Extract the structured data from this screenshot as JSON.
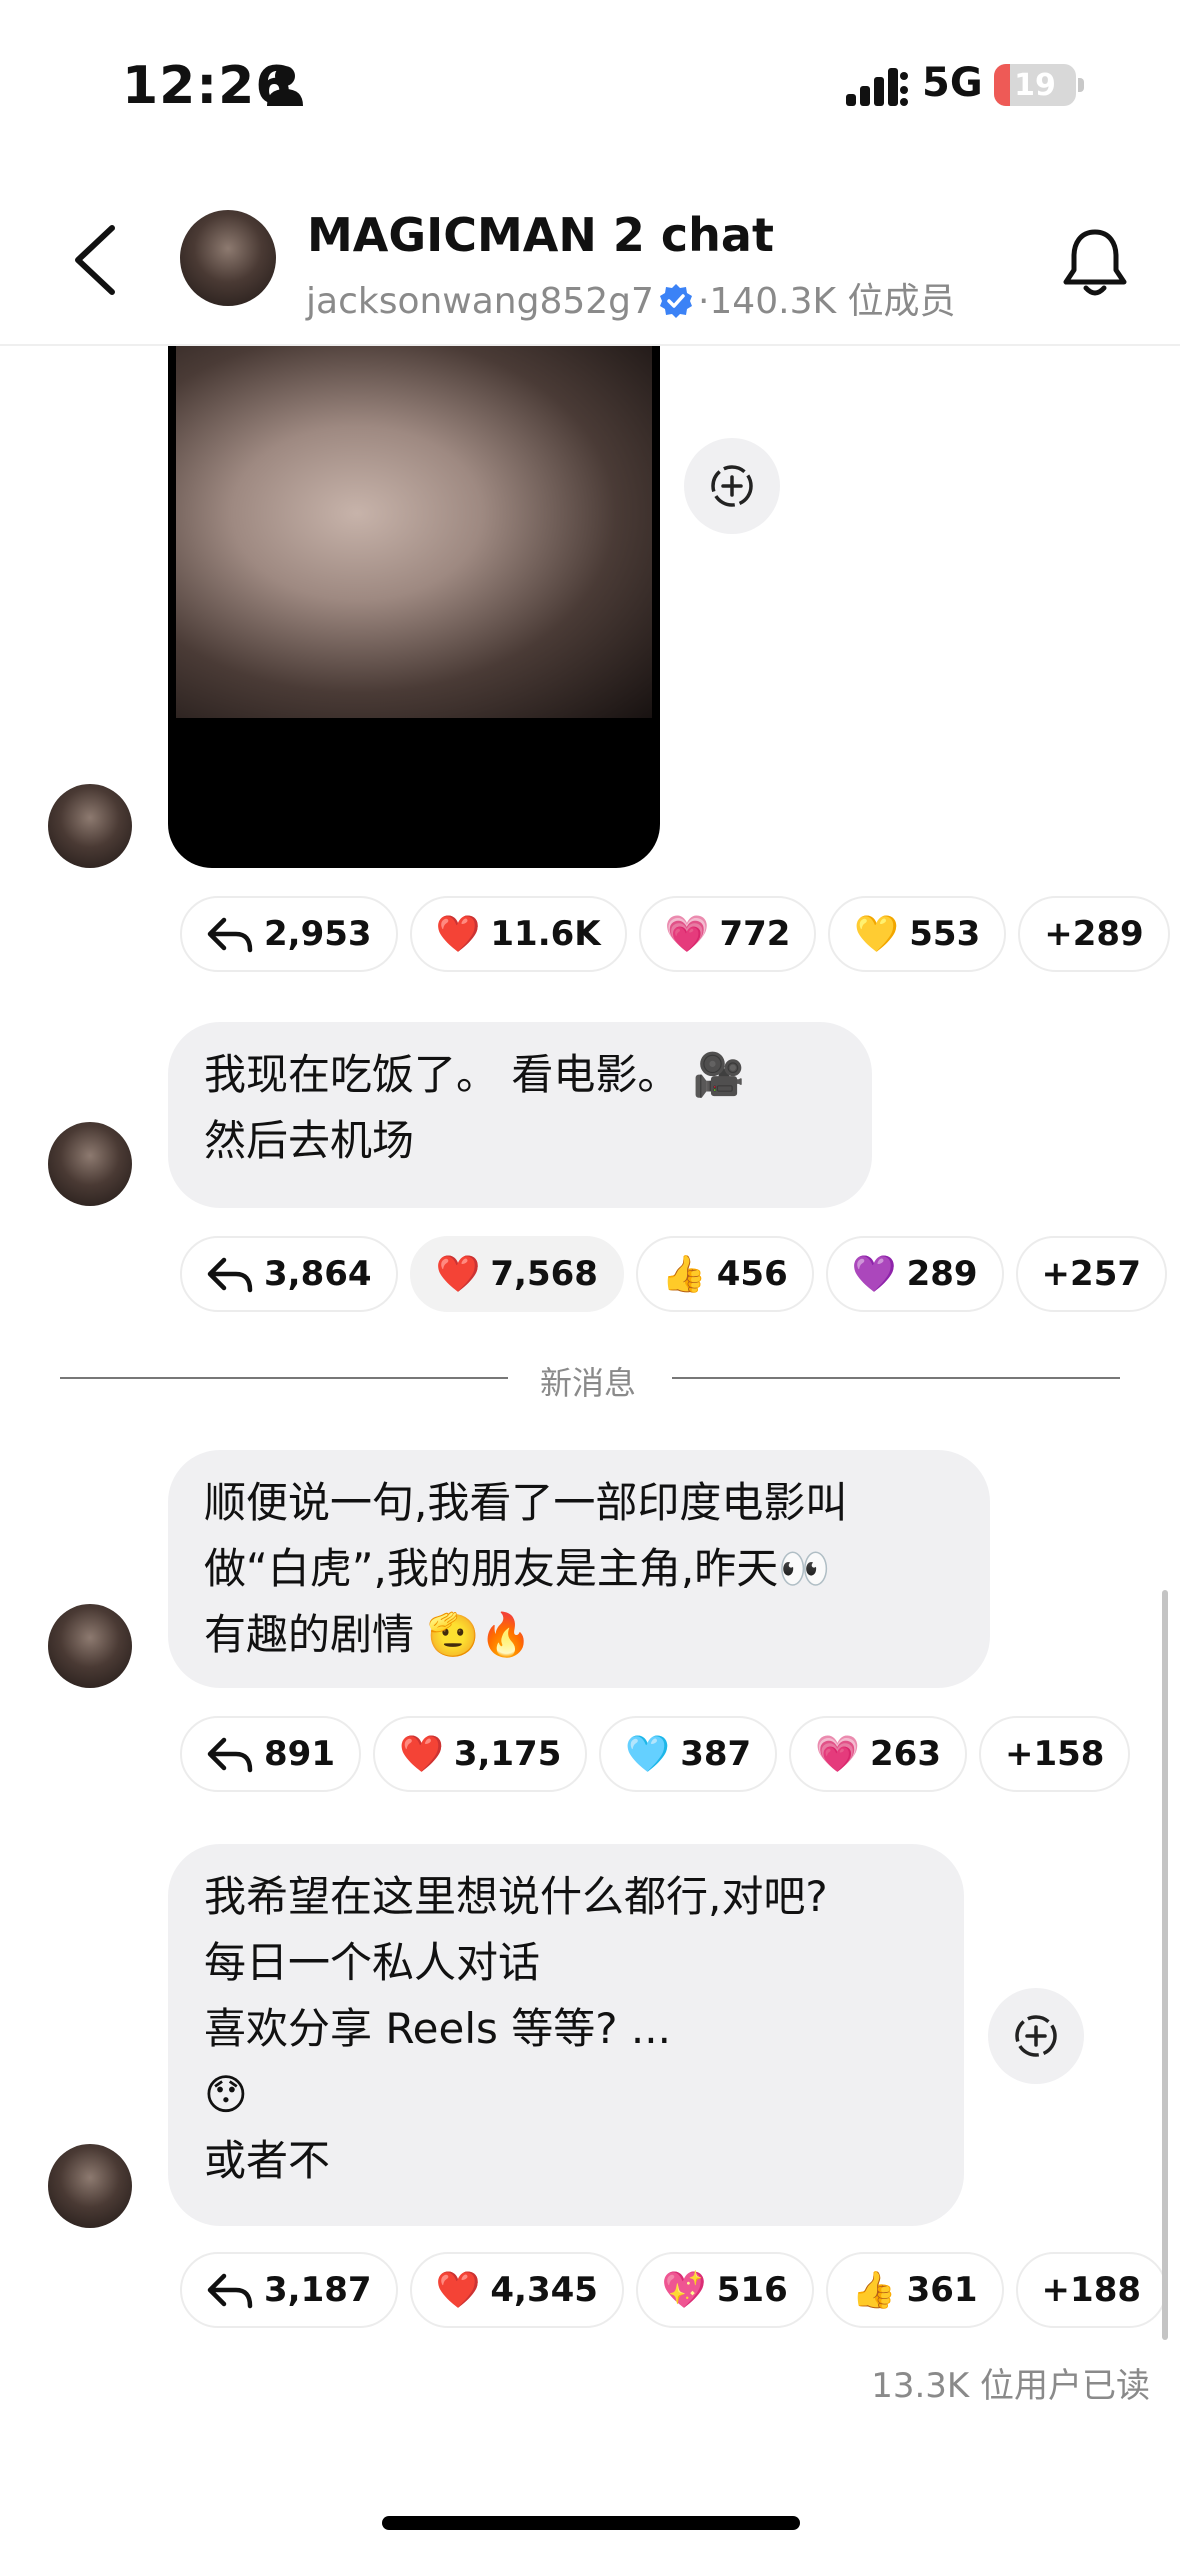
{
  "status_bar": {
    "time": "12:26",
    "network": "5G",
    "battery": "19",
    "battery_level": 0.19
  },
  "header": {
    "title": "MAGICMAN 2 chat",
    "username": "jacksonwang852g7",
    "separator": "·",
    "members": "140.3K 位成员",
    "accent_color": "#3b82f6"
  },
  "messages": [
    {
      "type": "photo",
      "reactions": [
        {
          "icon": "reply-icon",
          "count": "2,953"
        },
        {
          "emoji": "❤️",
          "count": "11.6K"
        },
        {
          "emoji": "💗",
          "count": "772"
        },
        {
          "emoji": "💛",
          "count": "553"
        },
        {
          "count": "+289"
        }
      ]
    },
    {
      "type": "text",
      "lines": [
        "我现在吃饭了。 看电影。 🎥",
        "然后去机场"
      ],
      "reactions": [
        {
          "icon": "reply-icon",
          "count": "3,864"
        },
        {
          "emoji": "❤️",
          "count": "7,568"
        },
        {
          "emoji": "👍",
          "count": "456"
        },
        {
          "emoji": "💜",
          "count": "289"
        },
        {
          "count": "+257"
        }
      ]
    },
    {
      "type": "text",
      "lines": [
        "顺便说一句,我看了一部印度电影叫",
        "做“白虎”,我的朋友是主角,昨天👀",
        "有趣的剧情 🫡🔥"
      ],
      "reactions": [
        {
          "icon": "reply-icon",
          "count": "891"
        },
        {
          "emoji": "❤️",
          "count": "3,175"
        },
        {
          "emoji": "🩵",
          "count": "387"
        },
        {
          "emoji": "💗",
          "count": "263"
        },
        {
          "count": "+158"
        }
      ]
    },
    {
      "type": "text",
      "lines": [
        "我希望在这里想说什么都行,对吧?",
        "每日一个私人对话",
        "喜欢分享 Reels 等等? ...",
        "😯",
        "或者不"
      ],
      "reactions": [
        {
          "icon": "reply-icon",
          "count": "3,187"
        },
        {
          "emoji": "❤️",
          "count": "4,345"
        },
        {
          "emoji": "💖",
          "count": "516"
        },
        {
          "emoji": "👍",
          "count": "361"
        },
        {
          "count": "+188"
        }
      ]
    }
  ],
  "divider": "新消息",
  "read_receipt": "13.3K 位用户已读"
}
